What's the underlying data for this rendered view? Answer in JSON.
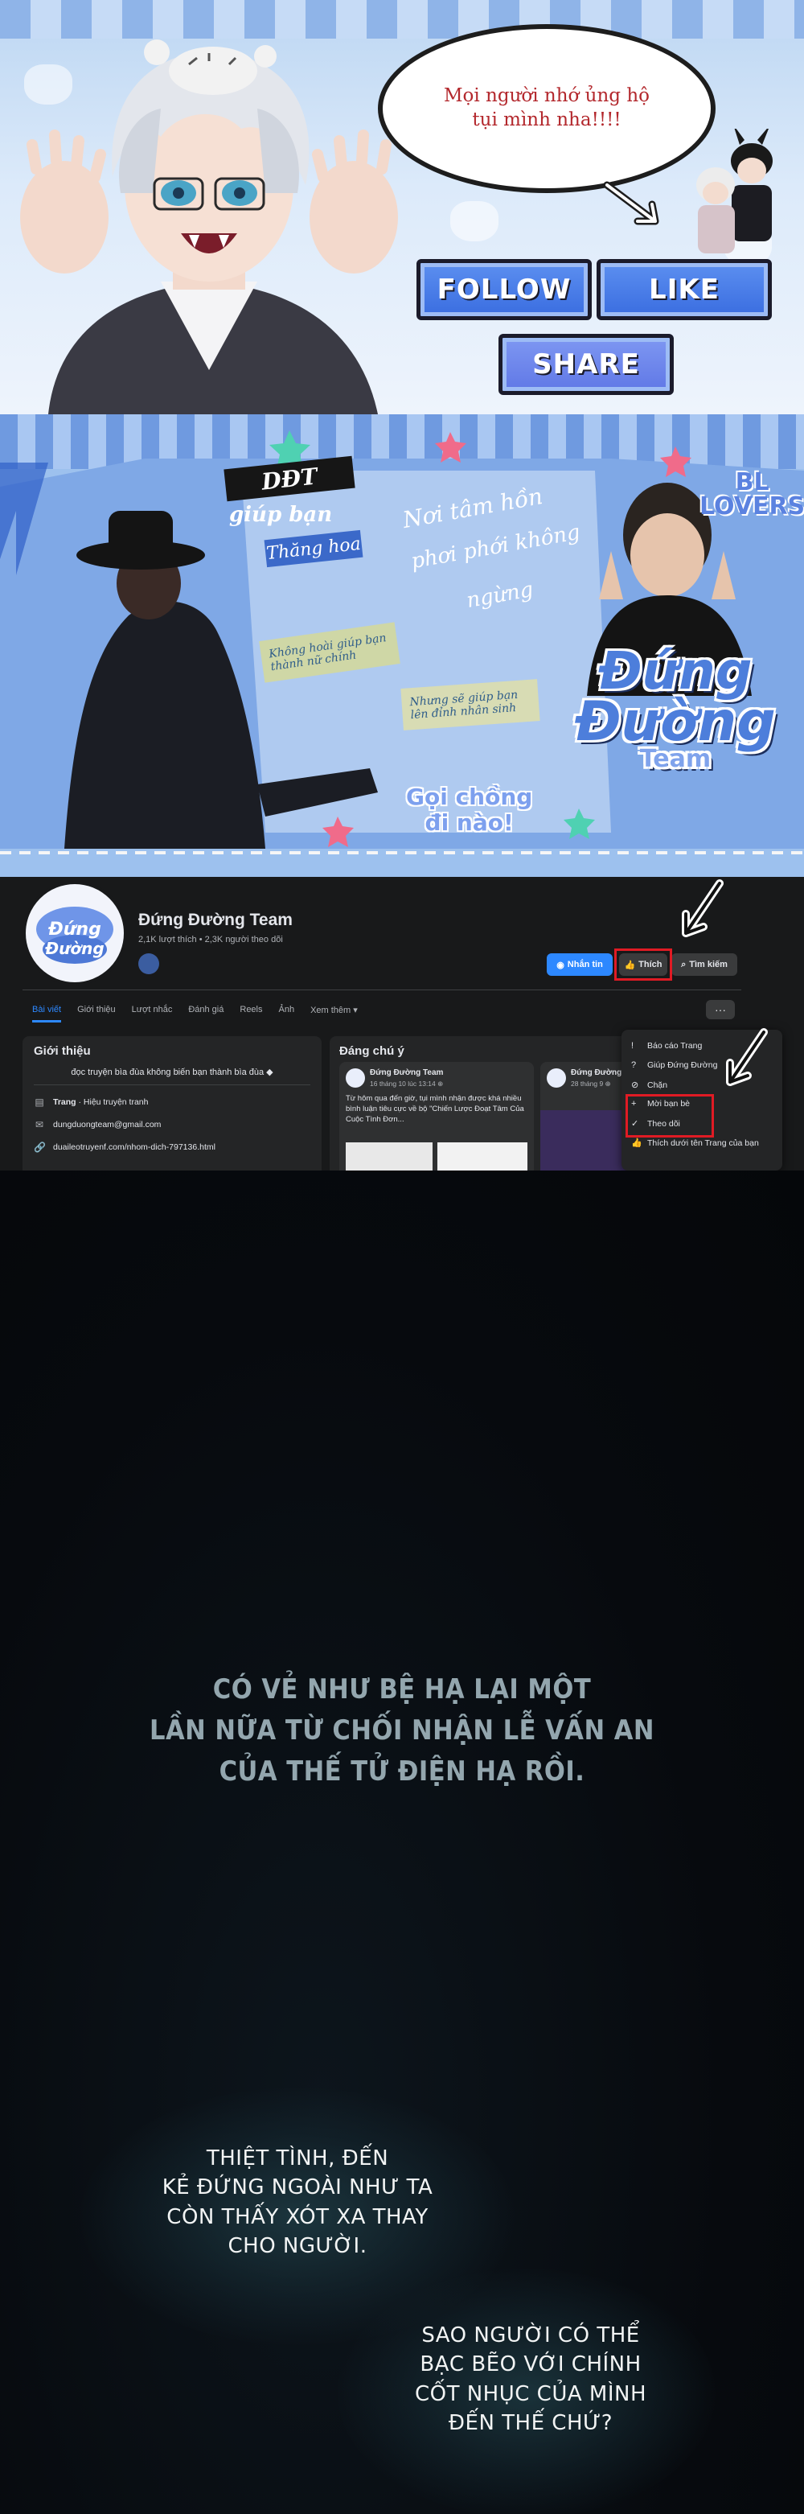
{
  "hero": {
    "bubble_text": "Mọi người nhớ ủng hộ tụi mình nha!!!!",
    "follow_label": "FOLLOW",
    "like_label": "LIKE",
    "share_label": "SHARE"
  },
  "banner": {
    "ddt_tag": "DĐT",
    "help_tag": "giúp bạn",
    "translate_tag": "Thăng hoa",
    "script_1": "Nơi tâm hồn",
    "script_2": "phơi phới không",
    "script_3": "ngừng",
    "note_left": "Không hoài giúp bạn thành nữ chính",
    "note_right": "Nhưng sẽ giúp bạn lên đỉnh nhân sinh",
    "bl_tag": "BL\nLOVERS",
    "team_line1": "Đứng",
    "team_line2": "Đường",
    "team_line3": "Team",
    "call_line1": "Gọi chồng",
    "call_line2": "đi nào!"
  },
  "facebook": {
    "page_name": "Đứng Đường Team",
    "stats": "2,1K lượt thích • 2,3K người theo dõi",
    "buttons": {
      "message": "Nhắn tin",
      "like": "Thích",
      "search": "Tìm kiếm"
    },
    "tabs": [
      "Bài viết",
      "Giới thiệu",
      "Lượt nhắc",
      "Đánh giá",
      "Reels",
      "Ảnh",
      "Xem thêm ▾"
    ],
    "more_glyph": "···",
    "intro": {
      "title": "Giới thiệu",
      "description": "đọc truyện bìa đùa không biến bạn thành bìa đùa ◆",
      "category_bold": "Trang",
      "category_rest": " · Hiệu truyện tranh",
      "email": "dungduongteam@gmail.com",
      "link": "duaileotruyenf.com/nhom-dich-797136.html"
    },
    "featured": {
      "title": "Đáng chú ý",
      "post1": {
        "name": "Đứng Đường Team",
        "date": "16 tháng 10 lúc 13:14 ⊕",
        "text": "Từ hôm qua đến giờ, tụi mình nhận được khá nhiều bình luận tiêu cực về bộ \"Chiến Lược Đoạt Tâm Của Cuộc Tình Đơn..."
      },
      "post2": {
        "name": "Đứng Đường",
        "date": "28 tháng 9 ⊕"
      }
    },
    "menu": [
      {
        "icon": "!",
        "label": "Báo cáo Trang"
      },
      {
        "icon": "?",
        "label": "Giúp Đứng Đường"
      },
      {
        "icon": "⊘",
        "label": "Chặn"
      },
      {
        "icon": "+",
        "label": "Mời bạn bè"
      },
      {
        "icon": "✓",
        "label": "Theo dõi"
      },
      {
        "icon": "👍",
        "label": "Thích dưới tên Trang của bạn"
      }
    ]
  },
  "panel": {
    "narration": [
      "CÓ VẺ NHƯ BỆ HẠ LẠI MỘT",
      "LẦN NỮA TỪ CHỐI NHẬN LỄ VẤN AN",
      "CỦA THẾ TỬ ĐIỆN HẠ RỒI."
    ],
    "dialogue1": [
      "THIỆT TÌNH, ĐẾN",
      "KẺ ĐỨNG NGOÀI NHƯ TA",
      "CÒN THẤY XÓT XA THAY",
      "CHO NGƯỜI."
    ],
    "dialogue2": [
      "SAO NGƯỜI CÓ THỂ",
      "BẠC BẼO VỚI CHÍNH",
      "CỐT NHỤC CỦA MÌNH",
      "ĐẾN THẾ CHỨ?"
    ]
  },
  "colors": {
    "fb_bg": "#18191a",
    "fb_card": "#242526",
    "fb_blue": "#2d88ff",
    "highlight_red": "#e01b24",
    "button_blue": "#3a6de0",
    "narration": "#93a6ae"
  }
}
